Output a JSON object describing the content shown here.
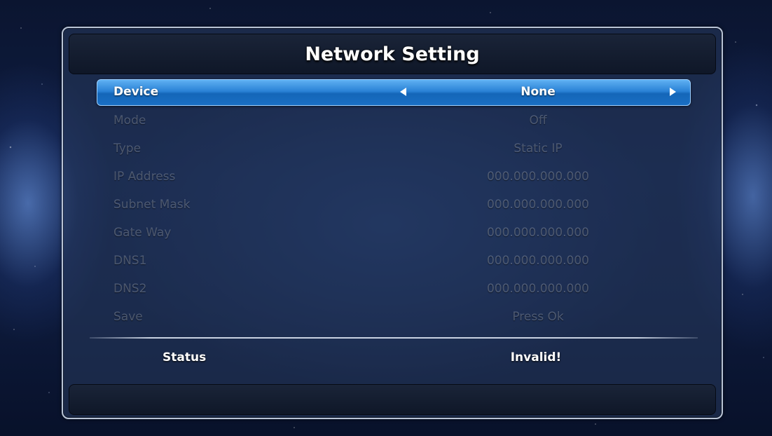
{
  "screen": {
    "title": "Network Setting"
  },
  "menu": {
    "items": [
      {
        "label": "Device",
        "value": "None"
      },
      {
        "label": "Mode",
        "value": "Off"
      },
      {
        "label": "Type",
        "value": "Static IP"
      },
      {
        "label": "IP Address",
        "value": "000.000.000.000"
      },
      {
        "label": "Subnet Mask",
        "value": "000.000.000.000"
      },
      {
        "label": "Gate Way",
        "value": "000.000.000.000"
      },
      {
        "label": "DNS1",
        "value": "000.000.000.000"
      },
      {
        "label": "DNS2",
        "value": "000.000.000.000"
      },
      {
        "label": "Save",
        "value": "Press Ok"
      }
    ],
    "selected_index": 0
  },
  "status": {
    "label": "Status",
    "value": "Invalid!"
  },
  "colors": {
    "highlight": "#2a82d6",
    "panel_border": "#b9c4d6",
    "disabled_text": "#c8d4e8"
  },
  "icons": {
    "prev": "triangle-left-icon",
    "next": "triangle-right-icon"
  }
}
